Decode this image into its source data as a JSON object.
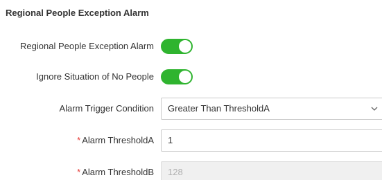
{
  "section": {
    "title": "Regional People Exception Alarm"
  },
  "form": {
    "regional_alarm": {
      "label": "Regional People Exception Alarm",
      "enabled": true
    },
    "ignore_no_people": {
      "label": "Ignore Situation of No People",
      "enabled": true
    },
    "trigger_condition": {
      "label": "Alarm Trigger Condition",
      "value": "Greater Than ThresholdA",
      "icon": "chevron-down-icon"
    },
    "threshold_a": {
      "required_mark": "*",
      "label": "Alarm ThresholdA",
      "value": "1"
    },
    "threshold_b": {
      "required_mark": "*",
      "label": "Alarm ThresholdB",
      "value": "128",
      "disabled": true
    }
  },
  "colors": {
    "toggle_on": "#2fb42f",
    "required": "#e53935",
    "disabled_bg": "#f0f0f0"
  }
}
